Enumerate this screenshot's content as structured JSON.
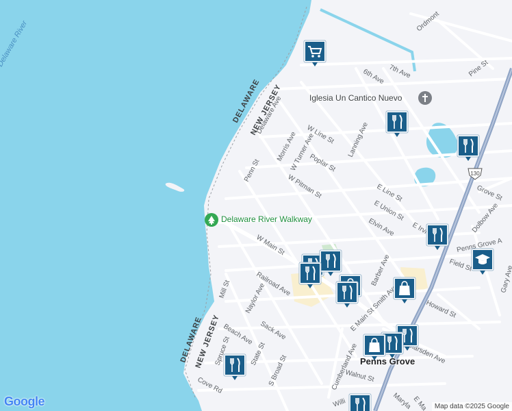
{
  "map": {
    "water_label": "Delaware River",
    "region_labels": {
      "delaware_north": "DELAWARE",
      "nj_north": "NEW JERSEY",
      "delaware_south": "DELAWARE",
      "nj_south": "NEW JERSEY"
    },
    "streets": {
      "ordmont": "Ordmont",
      "seventh_ave": "7th Ave",
      "sixth_ave": "6th Ave",
      "pine_st": "Pine St",
      "delaware_ave": "Delaware Ave",
      "lanning_ave": "Lanning Ave",
      "w_line_st": "W Line St",
      "morris_ave": "Morris Ave",
      "turner_ave": "W Turner Ave",
      "poplar_st": "Poplar St",
      "penn_st": "Penn St",
      "w_pitman_st": "W Pitman St",
      "grove_st": "Grove St",
      "e_line_st": "E Line St",
      "e_union_st": "E Union St",
      "elvin_ave": "Elvin Ave",
      "e_irvin": "E Irvin",
      "dolbow_ave": "Dolbow Ave",
      "w_main_st": "W Main St",
      "penns_a": "Penns Grove A",
      "field_st": "Field St",
      "gary_ave": "Gary Ave",
      "barber_ave": "Barber Ave",
      "railroad_ave": "Railroad Ave",
      "mill_st": "Mill St",
      "naylor_ave": "Naylor Ave",
      "howard_st": "Howard St",
      "sack_ave": "Sack Ave",
      "beach_ave": "Beach Ave",
      "e_main_smith": "E Main St Smith Ave",
      "marsden_ave": "Marsden Ave",
      "spruce_st": "Spruce St",
      "state_st": "State St",
      "cumberland_ave": "Cumberland Ave",
      "s_broad_st": "S Broad St",
      "walnut_st": "Walnut St",
      "cove_rd": "Cove Rd",
      "willis": "Willi",
      "maryland": "Maryla",
      "e_main": "E Ma"
    },
    "route_shield": "130",
    "pois": {
      "church": "Iglesia Un Cantico Nuevo",
      "park": "Delaware River Walkway",
      "town": "Penns Grove"
    },
    "icons": {
      "shopping_cart": "shopping-cart-icon",
      "restaurant": "fork-knife-icon",
      "shopping_bag": "shopping-bag-icon",
      "school": "graduation-cap-icon",
      "church": "cross-icon",
      "park": "tree-icon"
    },
    "logo": "Google",
    "attribution": "Map data ©2025 Google"
  },
  "colors": {
    "water": "#8ad4eb",
    "land": "#f3f4f8",
    "road": "#ffffff",
    "highway": "#8ea3c4",
    "pin": "#1a5e8a",
    "park": "#34a853"
  }
}
